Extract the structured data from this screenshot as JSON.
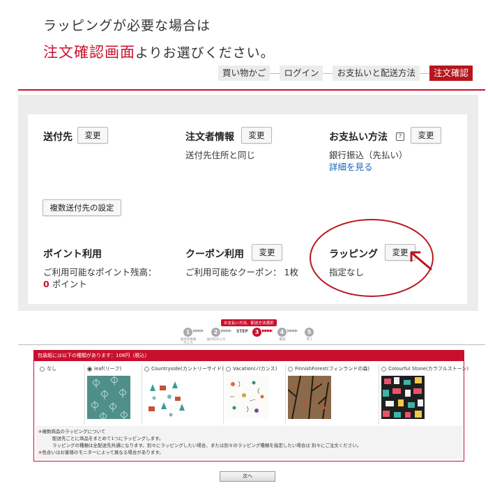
{
  "heading": {
    "line1": "ラッピングが必要な場合は",
    "line2_red": "注文確認画面",
    "line2_rest": "よりお選びください。"
  },
  "breadcrumbs": [
    "買い物かご",
    "ログイン",
    "お支払いと配送方法",
    "注文確認"
  ],
  "sections": {
    "shipping": {
      "title": "送付先",
      "button": "変更",
      "multi_button": "複数送付先の設定"
    },
    "orderer": {
      "title": "注文者情報",
      "button": "変更",
      "value": "送付先住所と同じ"
    },
    "payment": {
      "title": "お支払い方法",
      "help_icon": "?",
      "button": "変更",
      "value": "銀行振込（先払い）",
      "link": "詳細を見る"
    },
    "points": {
      "title": "ポイント利用",
      "label": "ご利用可能なポイント残高：",
      "value": "0",
      "unit": "ポイント"
    },
    "coupon": {
      "title": "クーポン利用",
      "button": "変更",
      "label": "ご利用可能なクーポン：",
      "value": "1枚"
    },
    "wrapping": {
      "title": "ラッピング",
      "button": "変更",
      "value": "指定なし"
    }
  },
  "steps": {
    "bubble": "お支払い方法、配送方法選択",
    "items": [
      {
        "num": "1",
        "label1": "送付先情報",
        "label2": "の入力"
      },
      {
        "num": "2",
        "label1": "送付先の入力",
        "label2": ""
      },
      {
        "num": "3",
        "prefix": "STEP"
      },
      {
        "num": "4",
        "label1": "確認",
        "label2": ""
      },
      {
        "num": "5",
        "label1": "完了",
        "label2": ""
      }
    ]
  },
  "wrapping_box": {
    "header": "包装紙には以下の種類があります：108円（税込）",
    "options": [
      {
        "label": "なし",
        "selected": false
      },
      {
        "label": "leaf(リーフ)",
        "selected": true
      },
      {
        "label": "Countryside(カントリーサイド)",
        "selected": false
      },
      {
        "label": "Vacation(バカンス)",
        "selected": false
      },
      {
        "label": "FinnishForest(フィンランドの森)",
        "selected": false
      },
      {
        "label": "Colourful Stone(カラフルストーン)",
        "selected": false
      }
    ],
    "notes": {
      "n1_mark": "※",
      "n1": "複数商品のラッピングについて",
      "n2": "配送先ごとに商品をまとめて1つにラッピングします。",
      "n3": "ラッピングの種類は全配送先共通になります。別々にラッピングしたい場合、または別々のラッピング種類を指定したい場合は 別々にご注文ください。",
      "n4_mark": "※",
      "n4": "色合いはお客様のモニターによって異なる場合があります。"
    }
  },
  "next_button": "次へ",
  "colors": {
    "accent": "#c8102e",
    "panel_bg": "#ececec",
    "link": "#1a63b8"
  }
}
